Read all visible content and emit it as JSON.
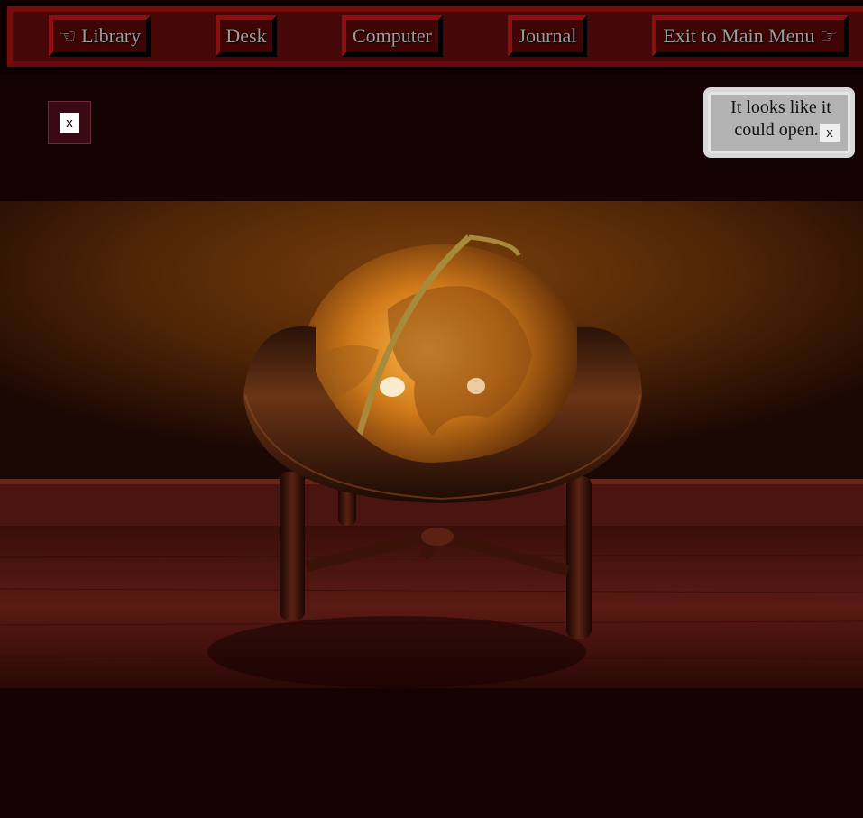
{
  "nav": {
    "library": "☜ Library",
    "desk": "Desk",
    "computer": "Computer",
    "journal": "Journal",
    "exit": "Exit to Main Menu ☞"
  },
  "panel": {
    "close_label": "x"
  },
  "hint": {
    "text": "It looks like it could open...",
    "close_label": "x"
  },
  "scene": {
    "subject": "antique globe on wooden stand",
    "icons": [
      "hand-left-icon",
      "hand-right-icon"
    ]
  },
  "colors": {
    "page_bg": "#150202",
    "nav_bg": "#450707",
    "nav_border": "#8b0f0f",
    "nav_text": "#9c9c9c"
  }
}
